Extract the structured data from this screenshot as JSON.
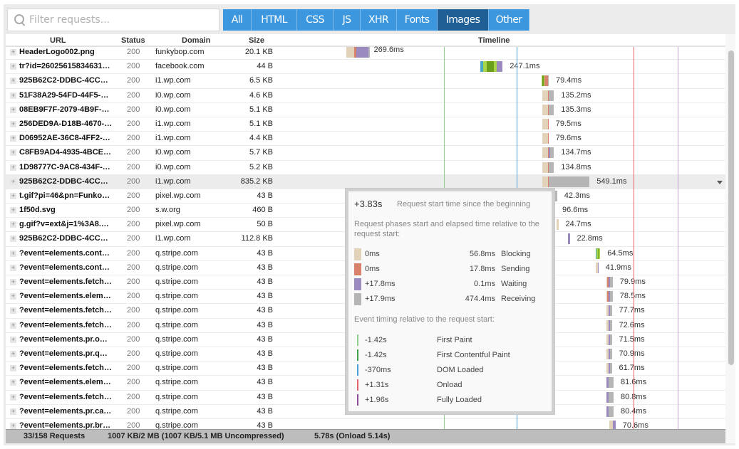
{
  "filter": {
    "placeholder": "Filter requests...",
    "value": ""
  },
  "type_filters": [
    {
      "label": "All",
      "active": false
    },
    {
      "label": "HTML",
      "active": false
    },
    {
      "label": "CSS",
      "active": false
    },
    {
      "label": "JS",
      "active": false
    },
    {
      "label": "XHR",
      "active": false
    },
    {
      "label": "Fonts",
      "active": false
    },
    {
      "label": "Images",
      "active": true
    },
    {
      "label": "Other",
      "active": false
    }
  ],
  "columns": {
    "url": "URL",
    "status": "Status",
    "domain": "Domain",
    "size": "Size",
    "timeline": "Timeline"
  },
  "colors": {
    "blocking": "#e2d2ba",
    "dns": "#4aa8c4",
    "connect": "#a8d54a",
    "ssl": "#6a9f1e",
    "sending": "#d8826b",
    "waiting": "#9b8ac0",
    "receiving": "#b5b5b5",
    "first_paint": "#8fce8f",
    "first_contentful_paint": "#3fa04a",
    "dom_loaded": "#4a9ed8",
    "onload": "#e9636a",
    "fully_loaded": "#8e4e9a",
    "accent": "#3d97de",
    "accent_active": "#1f5f95"
  },
  "rows": [
    {
      "url": "HeaderLogo002.png",
      "status": "200",
      "domain": "funkybop.com",
      "size": "20.1 KB",
      "duration": "269.6ms",
      "start_ms": 0,
      "segments": [
        [
          "blocking",
          9
        ],
        [
          "sending",
          2
        ],
        [
          "waiting",
          14
        ],
        [
          "receiving",
          1
        ]
      ]
    },
    {
      "url": "tr?id=26025615834631…",
      "status": "200",
      "domain": "facebook.com",
      "size": "44 B",
      "duration": "247.1ms",
      "start_ms": 0,
      "segments": [
        [
          "dns",
          3
        ],
        [
          "connect",
          4
        ],
        [
          "ssl",
          8
        ],
        [
          "connect",
          3
        ],
        [
          "waiting",
          7
        ]
      ]
    },
    {
      "url": "925B62C2-DDBC-4CC…",
      "status": "200",
      "domain": "i1.wp.com",
      "size": "6.5 KB",
      "duration": "79.4ms",
      "start_ms": 0,
      "segments": [
        [
          "connect",
          1
        ],
        [
          "ssl",
          1
        ],
        [
          "connect",
          1
        ],
        [
          "sending",
          4
        ],
        [
          "receiving",
          1
        ]
      ]
    },
    {
      "url": "51F38A29-54FD-44F5-…",
      "status": "200",
      "domain": "i0.wp.com",
      "size": "4.6 KB",
      "duration": "135.2ms",
      "start_ms": 0,
      "segments": [
        [
          "blocking",
          6
        ],
        [
          "sending",
          1
        ],
        [
          "receiving",
          6
        ]
      ]
    },
    {
      "url": "08EB9F7F-2079-4B9F-…",
      "status": "200",
      "domain": "i0.wp.com",
      "size": "5.1 KB",
      "duration": "135.3ms",
      "start_ms": 0,
      "segments": [
        [
          "blocking",
          6
        ],
        [
          "sending",
          1
        ],
        [
          "receiving",
          6
        ]
      ]
    },
    {
      "url": "256DED9A-D18B-4670-…",
      "status": "200",
      "domain": "i1.wp.com",
      "size": "5.1 KB",
      "duration": "79.5ms",
      "start_ms": 0,
      "segments": [
        [
          "blocking",
          6
        ],
        [
          "sending",
          1
        ]
      ]
    },
    {
      "url": "D06952AE-36C8-4FF2-…",
      "status": "200",
      "domain": "i1.wp.com",
      "size": "4.4 KB",
      "duration": "79.6ms",
      "start_ms": 0,
      "segments": [
        [
          "blocking",
          6
        ],
        [
          "sending",
          1
        ]
      ]
    },
    {
      "url": "C8FB9AD4-4935-4BCE…",
      "status": "200",
      "domain": "i0.wp.com",
      "size": "5.7 KB",
      "duration": "134.7ms",
      "start_ms": 0,
      "segments": [
        [
          "blocking",
          6
        ],
        [
          "sending",
          1
        ],
        [
          "waiting",
          2
        ],
        [
          "receiving",
          4
        ]
      ]
    },
    {
      "url": "1D98777C-9AC8-434F-…",
      "status": "200",
      "domain": "i0.wp.com",
      "size": "5.2 KB",
      "duration": "134.8ms",
      "start_ms": 0,
      "segments": [
        [
          "blocking",
          6
        ],
        [
          "sending",
          1
        ],
        [
          "receiving",
          6
        ]
      ]
    },
    {
      "url": "925B62C2-DDBC-4CC…",
      "status": "200",
      "domain": "i1.wp.com",
      "size": "835.2 KB",
      "duration": "549.1ms",
      "start_ms": 0,
      "selected": true,
      "segments": [
        [
          "blocking",
          6
        ],
        [
          "sending",
          1
        ],
        [
          "receiving",
          46
        ]
      ]
    },
    {
      "url": "t.gif?pi=46&pn=Funko…",
      "status": "200",
      "domain": "pixel.wp.com",
      "size": "43 B",
      "duration": "42.3ms",
      "start_ms": 0,
      "segments": [
        [
          "receiving",
          3
        ]
      ]
    },
    {
      "url": "1f50d.svg",
      "status": "200",
      "domain": "s.w.org",
      "size": "460 B",
      "duration": "96.6ms",
      "start_ms": 0,
      "segments": []
    },
    {
      "url": "g.gif?v=ext&j=1%3A8.…",
      "status": "200",
      "domain": "pixel.wp.com",
      "size": "50 B",
      "duration": "24.7ms",
      "start_ms": 0,
      "segments": [
        [
          "blocking",
          2
        ]
      ]
    },
    {
      "url": "925B62C2-DDBC-4CC…",
      "status": "200",
      "domain": "i1.wp.com",
      "size": "112.8 KB",
      "duration": "22.8ms",
      "start_ms": 0,
      "segments": [
        [
          "waiting",
          2
        ]
      ]
    },
    {
      "url": "?event=elements.cont…",
      "status": "200",
      "domain": "q.stripe.com",
      "size": "43 B",
      "duration": "64.5ms",
      "start_ms": 0,
      "segments": [
        [
          "dns",
          1
        ],
        [
          "connect",
          1
        ],
        [
          "ssl",
          1
        ],
        [
          "connect",
          2
        ]
      ]
    },
    {
      "url": "?event=elements.cont…",
      "status": "200",
      "domain": "q.stripe.com",
      "size": "43 B",
      "duration": "41.9ms",
      "start_ms": 0,
      "segments": [
        [
          "blocking",
          2
        ],
        [
          "waiting",
          1
        ]
      ]
    },
    {
      "url": "?event=elements.fetch…",
      "status": "200",
      "domain": "q.stripe.com",
      "size": "43 B",
      "duration": "79.9ms",
      "start_ms": 0,
      "segments": [
        [
          "blocking",
          1
        ],
        [
          "sending",
          1
        ],
        [
          "waiting",
          2
        ],
        [
          "receiving",
          3
        ]
      ]
    },
    {
      "url": "?event=elements.elem…",
      "status": "200",
      "domain": "q.stripe.com",
      "size": "43 B",
      "duration": "78.5ms",
      "start_ms": 0,
      "segments": [
        [
          "blocking",
          1
        ],
        [
          "sending",
          1
        ],
        [
          "waiting",
          2
        ],
        [
          "receiving",
          3
        ]
      ]
    },
    {
      "url": "?event=elements.fetch…",
      "status": "200",
      "domain": "q.stripe.com",
      "size": "43 B",
      "duration": "77.7ms",
      "start_ms": 0,
      "segments": [
        [
          "blocking",
          2
        ],
        [
          "waiting",
          2
        ],
        [
          "receiving",
          2
        ]
      ]
    },
    {
      "url": "?event=elements.fetch…",
      "status": "200",
      "domain": "q.stripe.com",
      "size": "43 B",
      "duration": "72.6ms",
      "start_ms": 0,
      "segments": [
        [
          "blocking",
          2
        ],
        [
          "waiting",
          2
        ],
        [
          "receiving",
          2
        ]
      ]
    },
    {
      "url": "?event=elements.pr.o…",
      "status": "200",
      "domain": "q.stripe.com",
      "size": "43 B",
      "duration": "71.5ms",
      "start_ms": 0,
      "segments": [
        [
          "blocking",
          2
        ],
        [
          "waiting",
          2
        ],
        [
          "receiving",
          2
        ]
      ]
    },
    {
      "url": "?event=elements.pr.q…",
      "status": "200",
      "domain": "q.stripe.com",
      "size": "43 B",
      "duration": "70.9ms",
      "start_ms": 0,
      "segments": [
        [
          "blocking",
          2
        ],
        [
          "waiting",
          2
        ],
        [
          "receiving",
          2
        ]
      ]
    },
    {
      "url": "?event=elements.fetch…",
      "status": "200",
      "domain": "q.stripe.com",
      "size": "43 B",
      "duration": "61.7ms",
      "start_ms": 0,
      "segments": [
        [
          "blocking",
          2
        ],
        [
          "waiting",
          2
        ],
        [
          "receiving",
          2
        ]
      ]
    },
    {
      "url": "?event=elements.elem…",
      "status": "200",
      "domain": "q.stripe.com",
      "size": "43 B",
      "duration": "81.6ms",
      "start_ms": 0,
      "segments": [
        [
          "waiting",
          2
        ],
        [
          "receiving",
          6
        ]
      ]
    },
    {
      "url": "?event=elements.fetch…",
      "status": "200",
      "domain": "q.stripe.com",
      "size": "43 B",
      "duration": "80.8ms",
      "start_ms": 0,
      "segments": [
        [
          "waiting",
          2
        ],
        [
          "receiving",
          6
        ]
      ]
    },
    {
      "url": "?event=elements.pr.ca…",
      "status": "200",
      "domain": "q.stripe.com",
      "size": "43 B",
      "duration": "80.4ms",
      "start_ms": 0,
      "segments": [
        [
          "waiting",
          2
        ],
        [
          "receiving",
          6
        ]
      ]
    },
    {
      "url": "?event=elements.pr.br…",
      "status": "200",
      "domain": "q.stripe.com",
      "size": "43 B",
      "duration": "70.6ms",
      "start_ms": 0,
      "segments": [
        [
          "blocking",
          4
        ],
        [
          "waiting",
          3
        ]
      ]
    }
  ],
  "footer": {
    "requests": "33/158 Requests",
    "size": "1007 KB/2 MB  (1007 KB/5.1 MB Uncompressed)",
    "time": "5.78s  (Onload 5.14s)"
  },
  "tooltip": {
    "start_time": "+3.83s",
    "start_desc": "Request start time since the beginning",
    "phase_desc": "Request phases start and elapsed time relative to the request start:",
    "phases": [
      {
        "start": "0ms",
        "duration": "56.8ms",
        "name": "Blocking",
        "color_key": "blocking"
      },
      {
        "start": "0ms",
        "duration": "17.8ms",
        "name": "Sending",
        "color_key": "sending"
      },
      {
        "start": "+17.8ms",
        "duration": "0.1ms",
        "name": "Waiting",
        "color_key": "waiting"
      },
      {
        "start": "+17.9ms",
        "duration": "474.4ms",
        "name": "Receiving",
        "color_key": "receiving"
      }
    ],
    "event_desc": "Event timing relative to the request start:",
    "events": [
      {
        "time": "-1.42s",
        "name": "First Paint",
        "color_key": "first_paint"
      },
      {
        "time": "-1.42s",
        "name": "First Contentful Paint",
        "color_key": "first_contentful_paint"
      },
      {
        "time": "-370ms",
        "name": "DOM Loaded",
        "color_key": "dom_loaded"
      },
      {
        "time": "+1.31s",
        "name": "Onload",
        "color_key": "onload"
      },
      {
        "time": "+1.96s",
        "name": "Fully Loaded",
        "color_key": "fully_loaded"
      }
    ]
  }
}
